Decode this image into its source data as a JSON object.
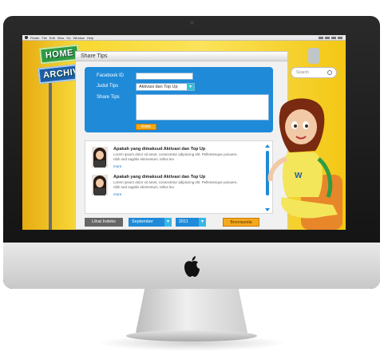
{
  "menubar": {
    "items": [
      "Finder",
      "File",
      "Edit",
      "View",
      "Go",
      "Window",
      "Help"
    ]
  },
  "signs": {
    "home": "HOME",
    "archive": "ARCHIVE"
  },
  "search": {
    "placeholder": "Search"
  },
  "panel": {
    "title": "Share Tips",
    "form": {
      "facebook_id_label": "Facebook ID",
      "facebook_id_value": "",
      "judul_tips_label": "Judul Tips",
      "judul_tips_selected": "Aktivasi dan Top Up",
      "share_tips_label": "Share Tips",
      "share_tips_value": "",
      "submit_label": "Kirim"
    },
    "list": [
      {
        "title": "Apakah yang dimaksud Aktivasi dan Top Up",
        "text": "Lorem ipsum dolor sit amet, consectetur adipiscing elit. Pellentesque posuere, nibh sed sagittis elementum, tellus leo",
        "more": "more"
      },
      {
        "title": "Apakah yang dimaksud Aktivasi dan Top Up",
        "text": "Lorem ipsum dolor sit amet, consectetur adipiscing elit. Pellentesque posuere, nibh sed sagittis elementum, tellus leo",
        "more": "more"
      }
    ],
    "bottom": {
      "index_label": "Lihat Indeks",
      "month": "September",
      "year": "2011",
      "broom_label": "Broompedia"
    }
  },
  "colors": {
    "accent": "#1f8ad8",
    "background": "#f6d21c",
    "button": "#f4a91c"
  }
}
